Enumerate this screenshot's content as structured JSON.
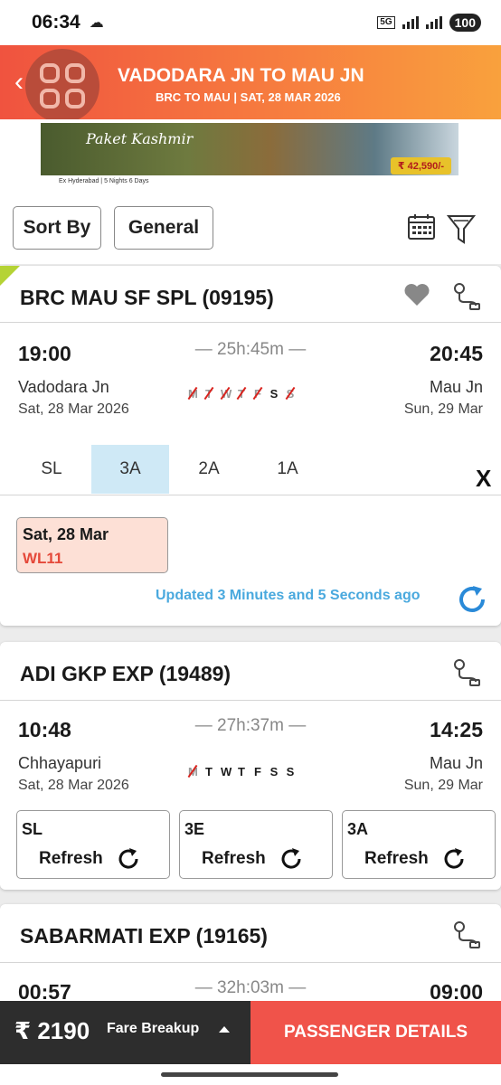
{
  "status": {
    "time": "06:34",
    "network": "5G",
    "battery": "100"
  },
  "header": {
    "title": "VADODARA JN TO MAU JN",
    "subtitle": "BRC TO MAU | SAT, 28 MAR  2026"
  },
  "banner": {
    "title": "Paket Kashmir",
    "price": "₹ 42,590/-",
    "strip_text": "Ex Hyderabad | 5 Nights 6 Days"
  },
  "filters": {
    "sort_label": "Sort By",
    "general_label": "General"
  },
  "trains": [
    {
      "name": "BRC MAU SF SPL (09195)",
      "dep_time": "19:00",
      "arr_time": "20:45",
      "duration": "25h:45m",
      "from_station": "Vadodara Jn",
      "to_station": "Mau Jn",
      "from_date": "Sat, 28 Mar  2026",
      "to_date": "Sun, 29 Mar",
      "days": [
        "M",
        "T",
        "W",
        "T",
        "F",
        "S",
        "S"
      ],
      "classes": [
        "SL",
        "3A",
        "2A",
        "1A"
      ],
      "selected_class": "3A",
      "availability": {
        "date": "Sat, 28 Mar",
        "status": "WL11"
      },
      "updated": "Updated 3 Minutes and 5 Seconds ago"
    },
    {
      "name": "ADI GKP EXP (19489)",
      "dep_time": "10:48",
      "arr_time": "14:25",
      "duration": "27h:37m",
      "from_station": "Chhayapuri",
      "to_station": "Mau Jn",
      "from_date": "Sat, 28 Mar  2026",
      "to_date": "Sun, 29 Mar",
      "days": [
        "M",
        "T",
        "W",
        "T",
        "F",
        "S",
        "S"
      ],
      "classes": [
        {
          "name": "SL",
          "action": "Refresh"
        },
        {
          "name": "3E",
          "action": "Refresh"
        },
        {
          "name": "3A",
          "action": "Refresh"
        }
      ]
    },
    {
      "name": "SABARMATI EXP (19165)",
      "dep_time": "00:57",
      "arr_time": "09:00",
      "duration": "32h:03m"
    }
  ],
  "close_label": "X",
  "bottom": {
    "fare": "₹ 2190",
    "fare_breakup": "Fare Breakup",
    "passenger_button": "PASSENGER DETAILS"
  }
}
